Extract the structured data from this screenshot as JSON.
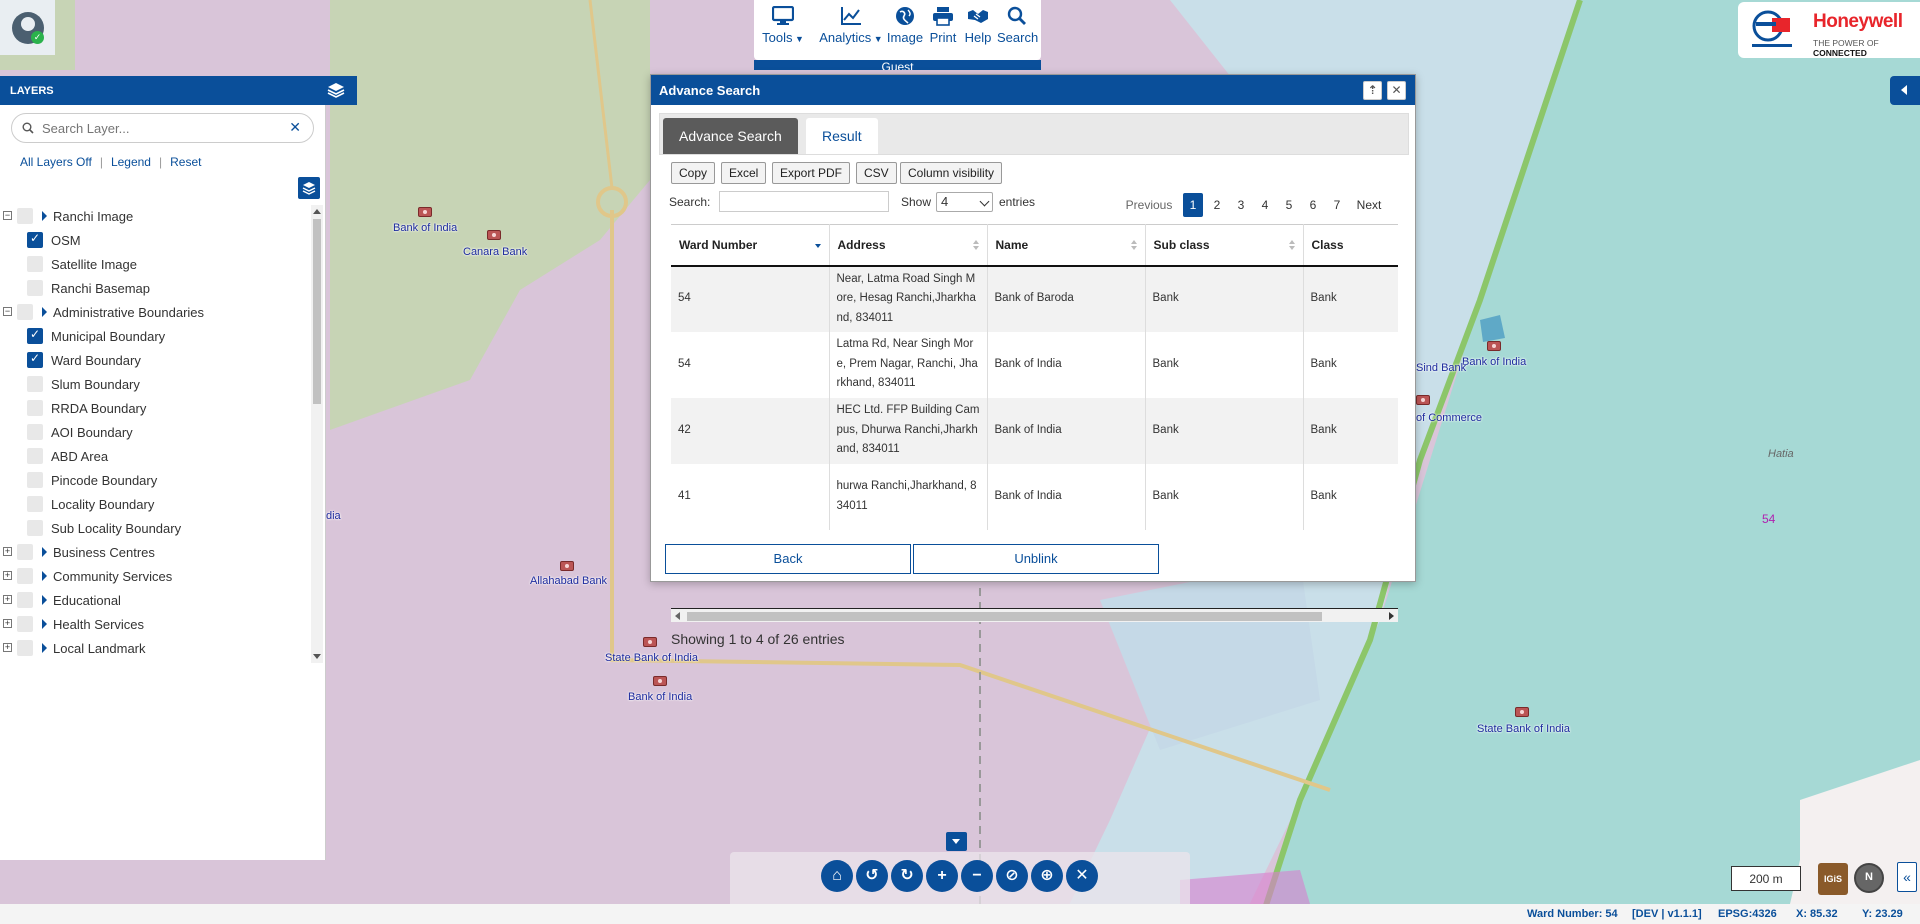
{
  "toolbar": {
    "items": [
      {
        "label": "Tools",
        "icon": "monitor-icon",
        "has_dropdown": true
      },
      {
        "label": "Analytics",
        "icon": "chart-line-icon",
        "has_dropdown": true
      },
      {
        "label": "Image",
        "icon": "globe-icon",
        "has_dropdown": false
      },
      {
        "label": "Print",
        "icon": "printer-icon",
        "has_dropdown": false
      },
      {
        "label": "Help",
        "icon": "handshake-icon",
        "has_dropdown": false
      },
      {
        "label": "Search",
        "icon": "search-icon",
        "has_dropdown": false
      }
    ],
    "user_label": "Guest"
  },
  "logo": {
    "brand": "Honeywell",
    "tagline_prefix": "THE POWER OF ",
    "tagline_bold": "CONNECTED"
  },
  "layers": {
    "title": "LAYERS",
    "search_placeholder": "Search Layer...",
    "clear_label": "✕",
    "links": [
      "All Layers Off",
      "Legend",
      "Reset"
    ],
    "tree": [
      {
        "label": "Ranchi Image",
        "level": 0,
        "checked": false,
        "group": true,
        "expanded": true
      },
      {
        "label": "OSM",
        "level": 1,
        "checked": true
      },
      {
        "label": "Satellite Image",
        "level": 1,
        "checked": false
      },
      {
        "label": "Ranchi Basemap",
        "level": 1,
        "checked": false
      },
      {
        "label": "Administrative Boundaries",
        "level": 0,
        "checked": false,
        "group": true,
        "expanded": true
      },
      {
        "label": "Municipal Boundary",
        "level": 1,
        "checked": true
      },
      {
        "label": "Ward Boundary",
        "level": 1,
        "checked": true
      },
      {
        "label": "Slum Boundary",
        "level": 1,
        "checked": false
      },
      {
        "label": "RRDA Boundary",
        "level": 1,
        "checked": false
      },
      {
        "label": "AOI Boundary",
        "level": 1,
        "checked": false
      },
      {
        "label": "ABD Area",
        "level": 1,
        "checked": false
      },
      {
        "label": "Pincode Boundary",
        "level": 1,
        "checked": false
      },
      {
        "label": "Locality Boundary",
        "level": 1,
        "checked": false
      },
      {
        "label": "Sub Locality Boundary",
        "level": 1,
        "checked": false
      },
      {
        "label": "Business Centres",
        "level": 0,
        "checked": false,
        "group": true,
        "expanded": false
      },
      {
        "label": "Community Services",
        "level": 0,
        "checked": false,
        "group": true,
        "expanded": false
      },
      {
        "label": "Educational",
        "level": 0,
        "checked": false,
        "group": true,
        "expanded": false
      },
      {
        "label": "Health Services",
        "level": 0,
        "checked": false,
        "group": true,
        "expanded": false
      },
      {
        "label": "Local Landmark",
        "level": 0,
        "checked": false,
        "group": true,
        "expanded": false
      }
    ]
  },
  "dialog": {
    "title": "Advance Search",
    "pin_label": "⇡",
    "close_label": "✕",
    "tabs": [
      "Advance Search",
      "Result"
    ],
    "export_buttons": [
      "Copy",
      "Excel",
      "Export PDF",
      "CSV",
      "Column visibility"
    ],
    "search_label": "Search:",
    "search_value": "",
    "show_label": "Show",
    "entries_value": "4",
    "entries_label": "entries",
    "pager": {
      "previous": "Previous",
      "pages": [
        "1",
        "2",
        "3",
        "4",
        "5",
        "6",
        "7"
      ],
      "current": "1",
      "next": "Next"
    },
    "columns": [
      "Ward Number",
      "Address",
      "Name",
      "Sub class",
      "Class"
    ],
    "rows": [
      [
        "54",
        "Near, Latma Road Singh More, Hesag Ranchi,Jharkhand, 834011",
        "Bank of Baroda",
        "Bank",
        "Bank"
      ],
      [
        "54",
        "Latma Rd, Near Singh More, Prem Nagar, Ranchi, Jharkhand, 834011",
        "Bank of India",
        "Bank",
        "Bank"
      ],
      [
        "42",
        "HEC Ltd. FFP Building Campus, Dhurwa Ranchi,Jharkhand, 834011",
        "Bank of India",
        "Bank",
        "Bank"
      ],
      [
        "41",
        "hurwa Ranchi,Jharkhand, 834011",
        "Bank of India",
        "Bank",
        "Bank"
      ]
    ],
    "info": "Showing 1 to 4 of 26 entries",
    "back_label": "Back",
    "unblink_label": "Unblink"
  },
  "map": {
    "labels": [
      {
        "text": "Bank of India",
        "kind": "bank"
      },
      {
        "text": "Canara Bank",
        "kind": "bank"
      },
      {
        "text": "Allahabad Bank",
        "kind": "bank"
      },
      {
        "text": "State Bank of India",
        "kind": "bank"
      },
      {
        "text": "Bank of India",
        "kind": "bank"
      },
      {
        "text": "Bank of India",
        "kind": "bank"
      },
      {
        "text": "Sind Bank",
        "kind": "bank"
      },
      {
        "text": "of Commerce",
        "kind": "bank"
      },
      {
        "text": "State Bank of India",
        "kind": "bank"
      },
      {
        "text": "Hatia",
        "kind": "place"
      },
      {
        "text": "54",
        "kind": "ward"
      },
      {
        "text": "dia",
        "kind": "bank"
      }
    ]
  },
  "nav": {
    "buttons": [
      {
        "icon": "home-icon",
        "glyph": "⌂"
      },
      {
        "icon": "undo-icon",
        "glyph": "↺"
      },
      {
        "icon": "redo-icon",
        "glyph": "↻"
      },
      {
        "icon": "zoom-in-icon",
        "glyph": "+"
      },
      {
        "icon": "zoom-out-icon",
        "glyph": "−"
      },
      {
        "icon": "hide-icon",
        "glyph": "⊘"
      },
      {
        "icon": "locate-icon",
        "glyph": "⊕"
      },
      {
        "icon": "clear-icon",
        "glyph": "✕"
      }
    ]
  },
  "scale": "200 m",
  "igis_label": "IGiS",
  "collapse_label": "«",
  "status": {
    "ward": "Ward Number: 54",
    "version": "[DEV | v1.1.1]",
    "epsg": "EPSG:4326",
    "x": "X: 85.32",
    "y": "Y: 23.29"
  },
  "colors": {
    "brand": "#0a4f9a",
    "honeywell": "#e8252b"
  }
}
